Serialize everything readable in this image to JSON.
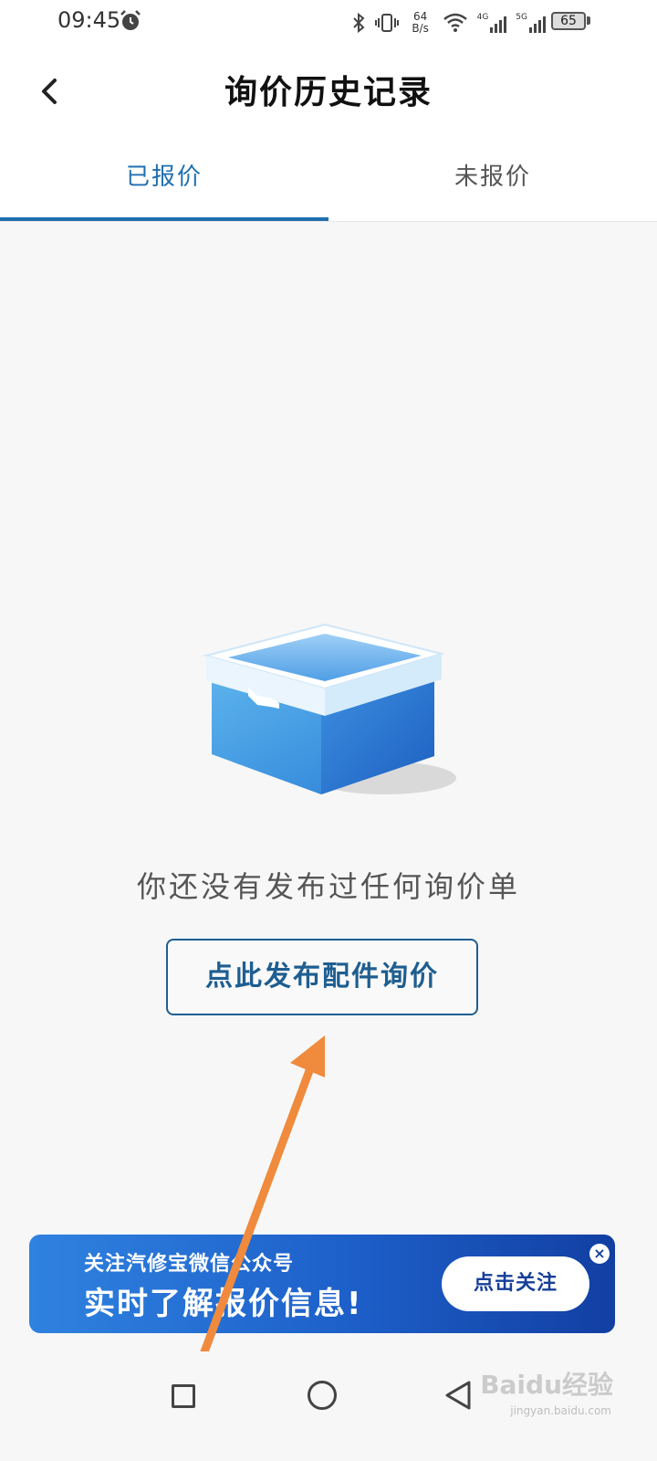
{
  "status_bar": {
    "time": "09:45",
    "net_speed_value": "64",
    "net_speed_unit": "B/s",
    "battery": "65",
    "cell1": "4G",
    "cell2": "5G"
  },
  "header": {
    "title": "询价历史记录"
  },
  "tabs": [
    {
      "label": "已报价",
      "active": true
    },
    {
      "label": "未报价",
      "active": false
    }
  ],
  "empty_state": {
    "message": "你还没有发布过任何询价单",
    "button_label": "点此发布配件询价"
  },
  "banner": {
    "line1": "关注汽修宝微信公众号",
    "line2": "实时了解报价信息!",
    "button_label": "点击关注",
    "close_label": "×"
  },
  "watermark": {
    "text": "Baidu经验",
    "url": "jingyan.baidu.com"
  },
  "colors": {
    "accent": "#1f6fb0",
    "button_text": "#1f5e90",
    "banner_start": "#2f82e0",
    "banner_end": "#123fa2",
    "arrow": "#f08a3c"
  }
}
